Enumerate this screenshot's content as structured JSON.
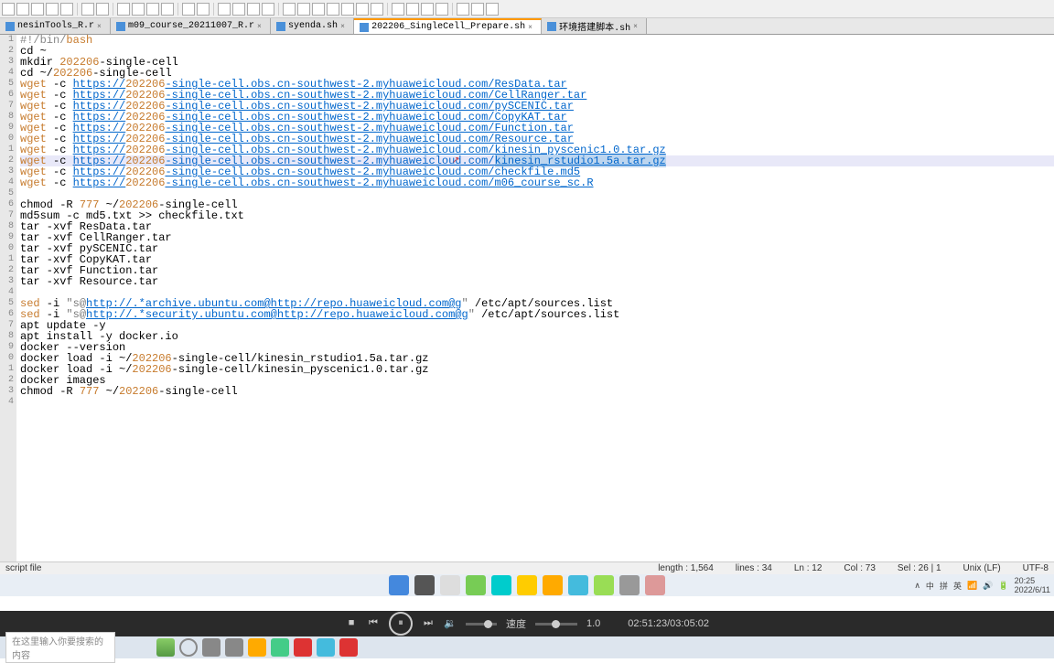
{
  "tabs": [
    {
      "label": "nesinTools_R.r"
    },
    {
      "label": "m09_course_20211007_R.r"
    },
    {
      "label": "syenda.sh"
    },
    {
      "label": "202206_SingleCell_Prepare.sh",
      "active": true
    },
    {
      "label": "环境搭建脚本.sh"
    }
  ],
  "code_lines": [
    {
      "n": "1",
      "parts": [
        {
          "t": "#!/bin/",
          "c": "kw-sh"
        },
        {
          "t": "bash",
          "c": "kw-num"
        }
      ]
    },
    {
      "n": "2",
      "parts": [
        {
          "t": "cd ~"
        }
      ]
    },
    {
      "n": "3",
      "parts": [
        {
          "t": "mkdir "
        },
        {
          "t": "202206",
          "c": "kw-num"
        },
        {
          "t": "-single-cell"
        }
      ]
    },
    {
      "n": "4",
      "parts": [
        {
          "t": "cd ~/"
        },
        {
          "t": "202206",
          "c": "kw-num"
        },
        {
          "t": "-single-cell"
        }
      ]
    },
    {
      "n": "5",
      "parts": [
        {
          "t": "wget",
          "c": "kw-num"
        },
        {
          "t": " -c "
        },
        {
          "t": "https://",
          "c": "kw-link"
        },
        {
          "t": "202206",
          "c": "kw-num"
        },
        {
          "t": "-single-cell.obs.cn-southwest-2.myhuaweicloud.com/ResData.tar",
          "c": "kw-link"
        }
      ]
    },
    {
      "n": "6",
      "parts": [
        {
          "t": "wget",
          "c": "kw-num"
        },
        {
          "t": " -c "
        },
        {
          "t": "https://",
          "c": "kw-link"
        },
        {
          "t": "202206",
          "c": "kw-num"
        },
        {
          "t": "-single-cell.obs.cn-southwest-2.myhuaweicloud.com/CellRanger.tar",
          "c": "kw-link"
        }
      ]
    },
    {
      "n": "7",
      "parts": [
        {
          "t": "wget",
          "c": "kw-num"
        },
        {
          "t": " -c "
        },
        {
          "t": "https://",
          "c": "kw-link"
        },
        {
          "t": "202206",
          "c": "kw-num"
        },
        {
          "t": "-single-cell.obs.cn-southwest-2.myhuaweicloud.com/pySCENIC.tar",
          "c": "kw-link"
        }
      ]
    },
    {
      "n": "8",
      "parts": [
        {
          "t": "wget",
          "c": "kw-num"
        },
        {
          "t": " -c "
        },
        {
          "t": "https://",
          "c": "kw-link"
        },
        {
          "t": "202206",
          "c": "kw-num"
        },
        {
          "t": "-single-cell.obs.cn-southwest-2.myhuaweicloud.com/CopyKAT.tar",
          "c": "kw-link"
        }
      ]
    },
    {
      "n": "9",
      "parts": [
        {
          "t": "wget",
          "c": "kw-num"
        },
        {
          "t": " -c "
        },
        {
          "t": "https://",
          "c": "kw-link"
        },
        {
          "t": "202206",
          "c": "kw-num"
        },
        {
          "t": "-single-cell.obs.cn-southwest-2.myhuaweicloud.com/Function.tar",
          "c": "kw-link"
        }
      ]
    },
    {
      "n": "0",
      "parts": [
        {
          "t": "wget",
          "c": "kw-num"
        },
        {
          "t": " -c "
        },
        {
          "t": "https://",
          "c": "kw-link"
        },
        {
          "t": "202206",
          "c": "kw-num"
        },
        {
          "t": "-single-cell.obs.cn-southwest-2.myhuaweicloud.com/Resource.tar",
          "c": "kw-link"
        }
      ]
    },
    {
      "n": "1",
      "parts": [
        {
          "t": "wget",
          "c": "kw-num"
        },
        {
          "t": " -c "
        },
        {
          "t": "https://",
          "c": "kw-link"
        },
        {
          "t": "202206",
          "c": "kw-num"
        },
        {
          "t": "-single-cell.obs.cn-southwest-2.myhuaweicloud.com/kinesin_pyscenic1.0.tar.gz",
          "c": "kw-link"
        }
      ]
    },
    {
      "n": "2",
      "hl": true,
      "parts": [
        {
          "t": "wget",
          "c": "kw-num"
        },
        {
          "t": " -c "
        },
        {
          "t": "https://",
          "c": "kw-link"
        },
        {
          "t": "202206",
          "c": "kw-num"
        },
        {
          "t": "-single-cell.obs.cn-southwest-2.myhuaweicloud.com/",
          "c": "kw-link"
        },
        {
          "t": "kinesin_rstudio1.5a.tar.gz",
          "c": "kw-link kw-sel"
        }
      ]
    },
    {
      "n": "3",
      "parts": [
        {
          "t": "wget",
          "c": "kw-num"
        },
        {
          "t": " -c "
        },
        {
          "t": "https://",
          "c": "kw-link"
        },
        {
          "t": "202206",
          "c": "kw-num"
        },
        {
          "t": "-single-cell.obs.cn-southwest-2.myhuaweicloud.com/checkfile.md5",
          "c": "kw-link"
        }
      ]
    },
    {
      "n": "4",
      "parts": [
        {
          "t": "wget",
          "c": "kw-num"
        },
        {
          "t": " -c "
        },
        {
          "t": "https://",
          "c": "kw-link"
        },
        {
          "t": "202206",
          "c": "kw-num"
        },
        {
          "t": "-single-cell.obs.cn-southwest-2.myhuaweicloud.com/m06_course_sc.R",
          "c": "kw-link"
        }
      ]
    },
    {
      "n": "5",
      "parts": []
    },
    {
      "n": "6",
      "parts": [
        {
          "t": "chmod -R "
        },
        {
          "t": "777",
          "c": "kw-num"
        },
        {
          "t": " ~/"
        },
        {
          "t": "202206",
          "c": "kw-num"
        },
        {
          "t": "-single-cell"
        }
      ]
    },
    {
      "n": "7",
      "parts": [
        {
          "t": "md5sum -c md5.txt >> checkfile.txt"
        }
      ]
    },
    {
      "n": "8",
      "parts": [
        {
          "t": "tar -xvf ResData.tar"
        }
      ]
    },
    {
      "n": "9",
      "parts": [
        {
          "t": "tar -xvf CellRanger.tar"
        }
      ]
    },
    {
      "n": "0",
      "parts": [
        {
          "t": "tar -xvf pySCENIC.tar"
        }
      ]
    },
    {
      "n": "1",
      "parts": [
        {
          "t": "tar -xvf CopyKAT.tar"
        }
      ]
    },
    {
      "n": "2",
      "parts": [
        {
          "t": "tar -xvf Function.tar"
        }
      ]
    },
    {
      "n": "3",
      "parts": [
        {
          "t": "tar -xvf Resource.tar"
        }
      ]
    },
    {
      "n": "4",
      "parts": []
    },
    {
      "n": "5",
      "parts": [
        {
          "t": "sed",
          "c": "kw-num"
        },
        {
          "t": " -i "
        },
        {
          "t": "\"s@",
          "c": "kw-str"
        },
        {
          "t": "http://.*archive.ubuntu.com@http://repo.huaweicloud.com@g",
          "c": "kw-link"
        },
        {
          "t": "\"",
          "c": "kw-str"
        },
        {
          "t": " /etc/apt/sources.list"
        }
      ]
    },
    {
      "n": "6",
      "parts": [
        {
          "t": "sed",
          "c": "kw-num"
        },
        {
          "t": " -i "
        },
        {
          "t": "\"s@",
          "c": "kw-str"
        },
        {
          "t": "http://.*security.ubuntu.com@http://repo.huaweicloud.com@g",
          "c": "kw-link"
        },
        {
          "t": "\"",
          "c": "kw-str"
        },
        {
          "t": " /etc/apt/sources.list"
        }
      ]
    },
    {
      "n": "7",
      "parts": [
        {
          "t": "apt update -y"
        }
      ]
    },
    {
      "n": "8",
      "parts": [
        {
          "t": "apt install -y docker.io"
        }
      ]
    },
    {
      "n": "9",
      "parts": [
        {
          "t": "docker --version"
        }
      ]
    },
    {
      "n": "0",
      "parts": [
        {
          "t": "docker load -i ~/"
        },
        {
          "t": "202206",
          "c": "kw-num"
        },
        {
          "t": "-single-cell/kinesin_rstudio1.5a.tar.gz"
        }
      ]
    },
    {
      "n": "1",
      "parts": [
        {
          "t": "docker load -i ~/"
        },
        {
          "t": "202206",
          "c": "kw-num"
        },
        {
          "t": "-single-cell/kinesin_pyscenic1.0.tar.gz"
        }
      ]
    },
    {
      "n": "2",
      "parts": [
        {
          "t": "docker images"
        }
      ]
    },
    {
      "n": "3",
      "parts": [
        {
          "t": "chmod -R "
        },
        {
          "t": "777",
          "c": "kw-num"
        },
        {
          "t": " ~/"
        },
        {
          "t": "202206",
          "c": "kw-num"
        },
        {
          "t": "-single-cell"
        }
      ]
    },
    {
      "n": "4",
      "parts": []
    }
  ],
  "status": {
    "left": "script file",
    "length": "length : 1,564",
    "lines": "lines : 34",
    "ln": "Ln : 12",
    "col": "Col : 73",
    "sel": "Sel : 26 | 1",
    "eol": "Unix (LF)",
    "enc": "UTF-8"
  },
  "system_tray": {
    "ime": "中",
    "input": "拼",
    "net": "英",
    "time": "20:25",
    "date": "2022/6/11"
  },
  "video": {
    "speed_label": "速度",
    "speed_val": "1.0",
    "time": "02:51:23/03:05:02"
  },
  "search_placeholder": "在这里输入你要搜索的内容",
  "taskbar_apps": [
    "#4488dd",
    "#555",
    "#ddd",
    "#7c5",
    "#0cc",
    "#fc0",
    "#fa0",
    "#4bd",
    "#9d5",
    "#999",
    "#d99"
  ],
  "bottom_apps": [
    "#888",
    "#888",
    "#fa0",
    "#4c8",
    "#d33",
    "#4bd",
    "#d33"
  ]
}
